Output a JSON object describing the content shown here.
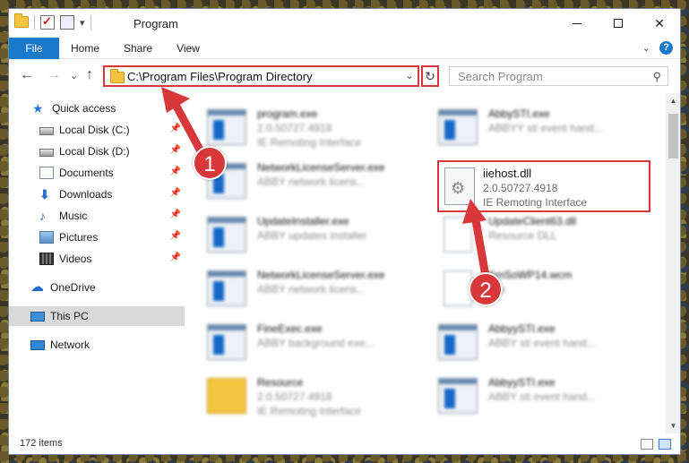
{
  "window": {
    "title": "Program",
    "controls": {
      "minimize": "",
      "maximize": "",
      "close": "✕"
    }
  },
  "ribbon": {
    "tabs": [
      "File",
      "Home",
      "Share",
      "View"
    ],
    "help": "?",
    "collapse": "⌄"
  },
  "nav": {
    "back": "←",
    "forward": "→",
    "recent": "⌄",
    "up": "↑",
    "address": "C:\\Program Files\\Program Directory",
    "address_dropdown": "⌄",
    "refresh": "↻",
    "search_placeholder": "Search Program",
    "search_icon": "⚲"
  },
  "sidebar": {
    "items": [
      {
        "label": "Quick access",
        "icon": "star-icon",
        "pinned": false,
        "selected": false
      },
      {
        "label": "Local Disk (C:)",
        "icon": "drive-icon",
        "pinned": true,
        "selected": false
      },
      {
        "label": "Local Disk (D:)",
        "icon": "drive-icon",
        "pinned": true,
        "selected": false
      },
      {
        "label": "Documents",
        "icon": "documents-icon",
        "pinned": true,
        "selected": false
      },
      {
        "label": "Downloads",
        "icon": "downloads-icon",
        "pinned": true,
        "selected": false
      },
      {
        "label": "Music",
        "icon": "music-icon",
        "pinned": true,
        "selected": false
      },
      {
        "label": "Pictures",
        "icon": "pictures-icon",
        "pinned": true,
        "selected": false
      },
      {
        "label": "Videos",
        "icon": "videos-icon",
        "pinned": true,
        "selected": false
      },
      {
        "label": "OneDrive",
        "icon": "onedrive-icon",
        "pinned": false,
        "selected": false
      },
      {
        "label": "This PC",
        "icon": "this-pc-icon",
        "pinned": false,
        "selected": true
      },
      {
        "label": "Network",
        "icon": "network-icon",
        "pinned": false,
        "selected": false
      }
    ],
    "pin_glyph": "📌"
  },
  "files": [
    {
      "name": "program.exe",
      "line1": "2.0.50727.4918",
      "line2": "IE Remoting Interface",
      "icon": "exe"
    },
    {
      "name": "AbbySTI.exe",
      "line1": "ABBYY sti event hand...",
      "line2": "",
      "icon": "exe"
    },
    {
      "name": "NetworkLicenseServer.exe",
      "line1": "ABBY network licens...",
      "line2": "",
      "icon": "exe"
    },
    {
      "name": "UpdateInstaller.exe",
      "line1": "ABBY updates installer",
      "line2": "",
      "icon": "exe"
    },
    {
      "name": "UpdateClient63.dll",
      "line1": "Resource DLL",
      "line2": "",
      "icon": "file"
    },
    {
      "name": "NetworkLicenseServer.exe",
      "line1": "ABBY network licens...",
      "line2": "",
      "icon": "exe"
    },
    {
      "name": "SmSoWP14.wcm",
      "line1": "File",
      "line2": "",
      "icon": "file"
    },
    {
      "name": "FineExec.exe",
      "line1": "ABBY background exe...",
      "line2": "",
      "icon": "exe"
    },
    {
      "name": "AbbyySTI.exe",
      "line1": "ABBY sti event hand...",
      "line2": "",
      "icon": "exe"
    },
    {
      "name": "Resource",
      "line1": "2.0.50727.4918",
      "line2": "IE Remoting Interface",
      "icon": "folder"
    },
    {
      "name": "AbbyySTI.exe",
      "line1": "ABBY sti event hand...",
      "line2": "",
      "icon": "exe"
    }
  ],
  "highlighted_file": {
    "name": "iiehost.dll",
    "version": "2.0.50727.4918",
    "description": "IE Remoting Interface"
  },
  "status": {
    "item_count": "172 items"
  },
  "annotations": {
    "badge_1": "1",
    "badge_2": "2",
    "color": "#d9383a"
  },
  "colors": {
    "accent": "#1979ca",
    "highlight_red": "#d9383a",
    "selection": "#d9d9d9"
  }
}
